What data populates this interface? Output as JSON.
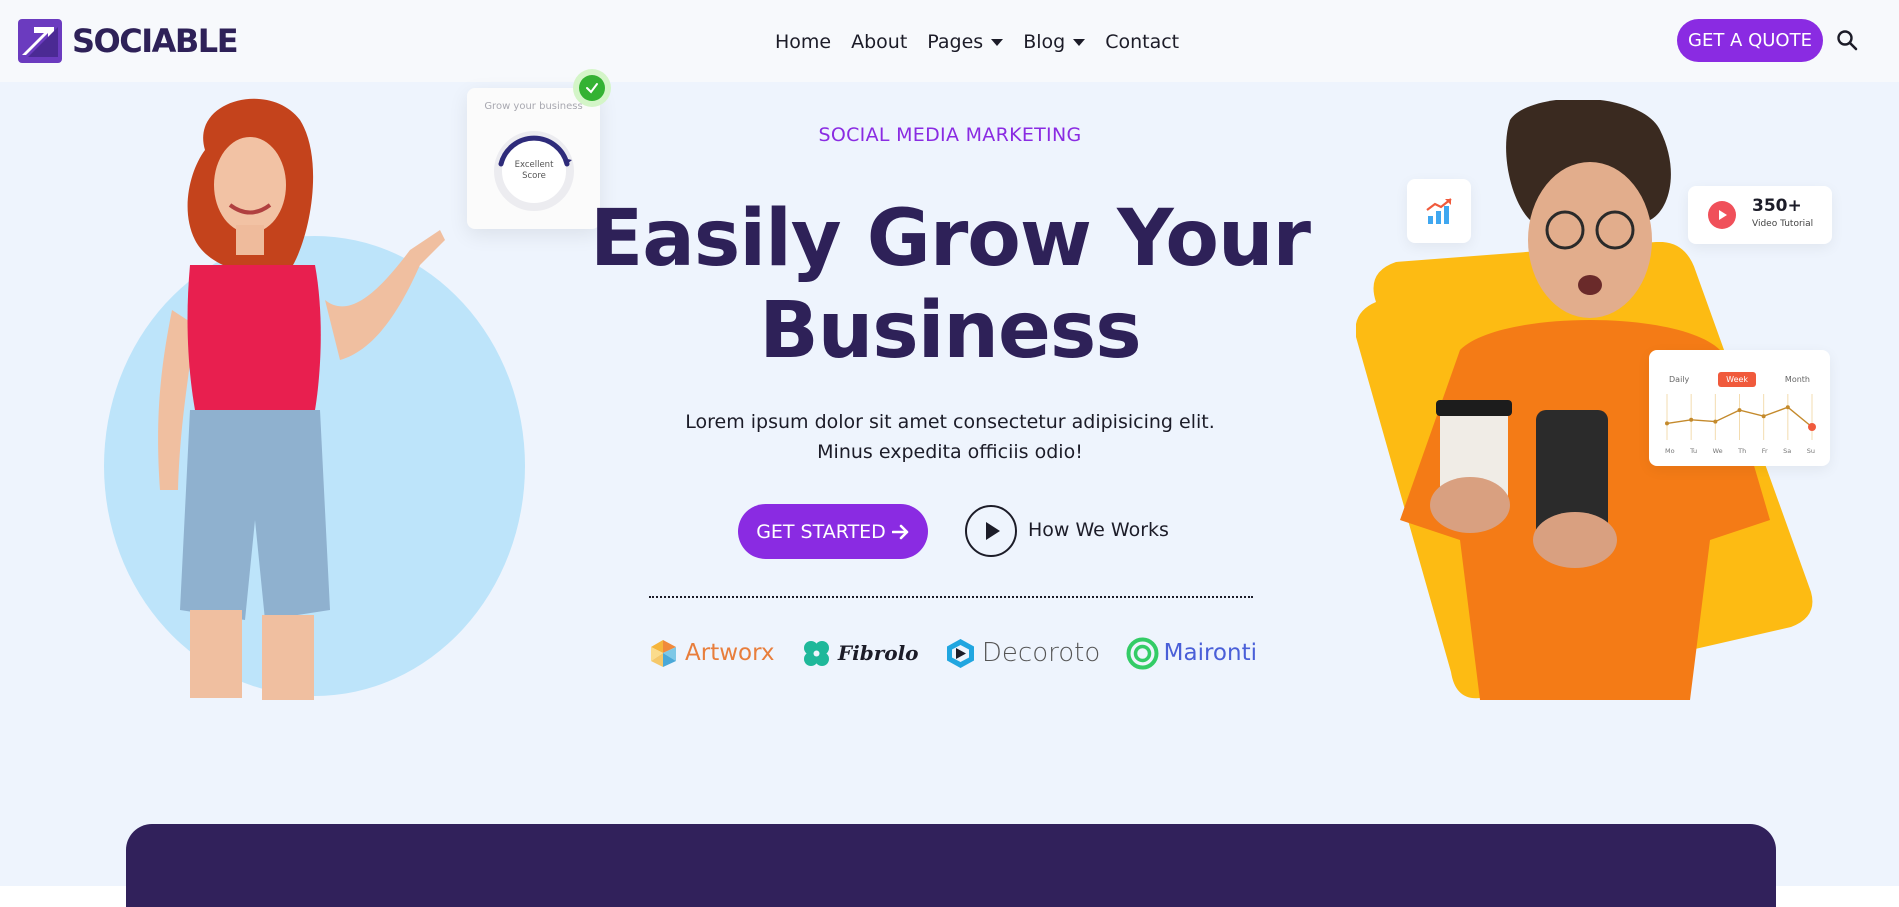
{
  "brand": {
    "name": "SOCIABLE"
  },
  "nav": {
    "items": [
      {
        "label": "Home",
        "dropdown": false
      },
      {
        "label": "About",
        "dropdown": false
      },
      {
        "label": "Pages",
        "dropdown": true
      },
      {
        "label": "Blog",
        "dropdown": true
      },
      {
        "label": "Contact",
        "dropdown": false
      }
    ],
    "quote_label": "GET A QUOTE"
  },
  "hero": {
    "eyebrow": "SOCIAL MEDIA MARKETING",
    "headline_line1": "Easily Grow Your",
    "headline_line2": "Business",
    "lead": "Lorem ipsum dolor sit amet consectetur adipisicing elit. Minus expedita officiis odio!",
    "start_label": "GET STARTED",
    "how_label": "How We Works"
  },
  "score_card": {
    "title": "Grow your business",
    "label": "Excellent Score"
  },
  "video_card": {
    "count": "350+",
    "label": "Video Tutorial"
  },
  "stats_card": {
    "tabs": [
      "Daily",
      "Week",
      "Month"
    ],
    "active_tab": "Week",
    "days": [
      "Mo",
      "Tu",
      "We",
      "Th",
      "Fr",
      "Sa",
      "Su"
    ],
    "values": [
      0.35,
      0.45,
      0.4,
      0.72,
      0.55,
      0.8,
      0.25
    ]
  },
  "brands": [
    {
      "name": "Artworx",
      "icon": "artworx-icon",
      "color": "#e87e3c"
    },
    {
      "name": "Fibrolo",
      "icon": "clover-icon",
      "color": "#1c1c28"
    },
    {
      "name": "Decoroto",
      "icon": "decoroto-icon",
      "color": "#555555"
    },
    {
      "name": "Maironti",
      "icon": "maironti-icon",
      "color": "#4a5fd8"
    }
  ],
  "colors": {
    "accent": "#8a2be2",
    "heading": "#2e2158",
    "background": "#eef4fd",
    "panel": "#31215b",
    "circle": "#bde4fa",
    "yellow": "#fdbb13"
  }
}
